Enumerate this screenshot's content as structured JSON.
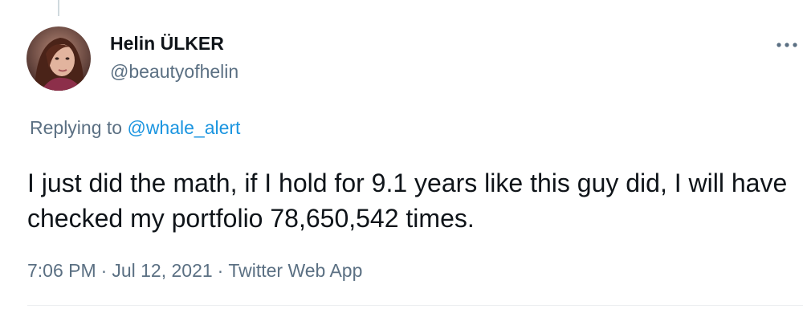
{
  "user": {
    "display_name": "Helin ÜLKER",
    "handle": "@beautyofhelin"
  },
  "reply": {
    "prefix": "Replying to",
    "mention": "@whale_alert"
  },
  "tweet": {
    "text": "I just did the math, if I hold for 9.1 years like this guy did, I will have checked my portfolio 78,650,542 times."
  },
  "meta": {
    "time": "7:06 PM",
    "separator": "·",
    "date": "Jul 12, 2021",
    "client": "Twitter Web App"
  },
  "icons": {
    "more": "more-horizontal-icon",
    "avatar": "profile-photo"
  },
  "colors": {
    "text": "#0f1419",
    "secondary": "#5b7083",
    "link": "#1b95e0",
    "divider": "#ebeef0"
  }
}
